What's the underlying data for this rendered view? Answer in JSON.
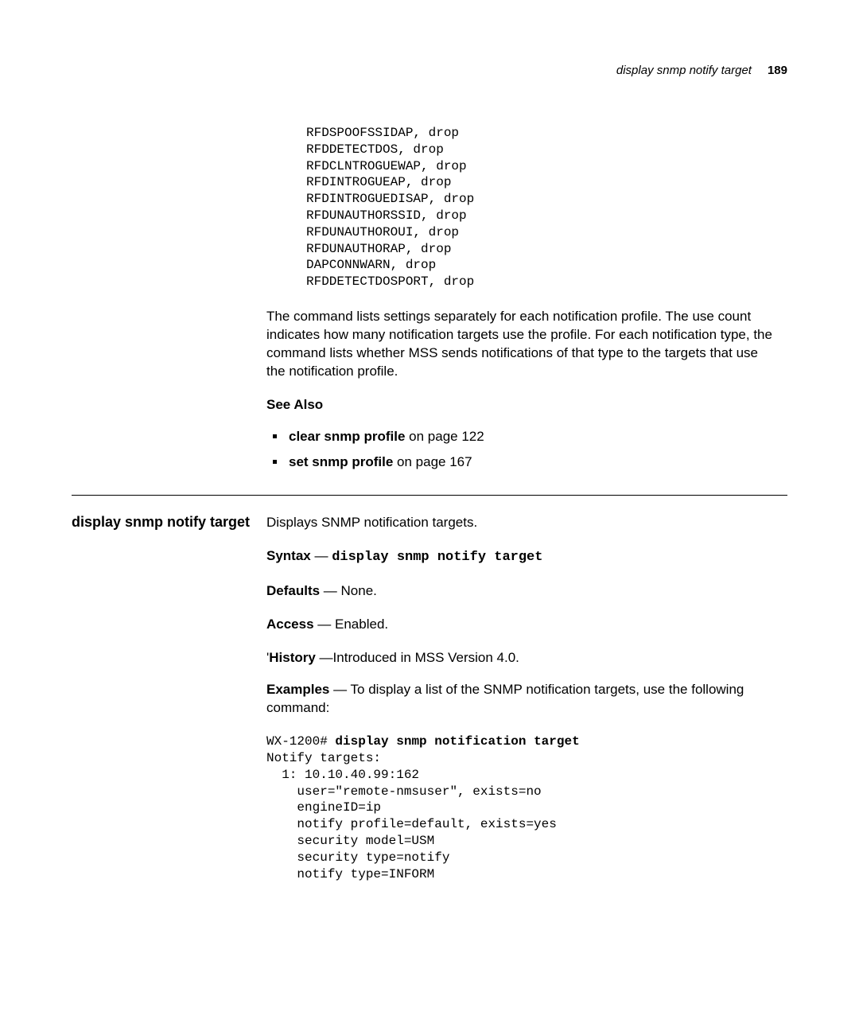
{
  "header": {
    "title": "display snmp notify target",
    "page": "189"
  },
  "upper": {
    "codeLines": "RFDSPOOFSSIDAP, drop\nRFDDETECTDOS, drop\nRFDCLNTROGUEWAP, drop\nRFDINTROGUEAP, drop\nRFDINTROGUEDISAP, drop\nRFDUNAUTHORSSID, drop\nRFDUNAUTHOROUI, drop\nRFDUNAUTHORAP, drop\nDAPCONNWARN, drop\nRFDDETECTDOSPORT, drop",
    "paragraph": "The command lists settings separately for each notification profile. The use count indicates how many notification targets use the profile. For each notification type, the command lists whether MSS sends notifications of that type to the targets that use the notification profile.",
    "seeAlsoHeading": "See Also",
    "seeAlso": [
      {
        "bold": "clear snmp profile",
        "rest": " on page 122"
      },
      {
        "bold": "set snmp profile",
        "rest": " on page 167"
      }
    ]
  },
  "section": {
    "sidebarTitle": "display snmp notify target",
    "intro": "Displays SNMP notification targets.",
    "syntax": {
      "label": "Syntax",
      "dash": " — ",
      "command": "display snmp notify target"
    },
    "defaults": {
      "label": "Defaults",
      "value": " — None."
    },
    "access": {
      "label": "Access",
      "value": " — Enabled."
    },
    "history": {
      "prefix": "'",
      "label": "History",
      "value": " —Introduced in MSS Version 4.0."
    },
    "examples": {
      "label": "Examples",
      "value": " — To display a list of the SNMP notification targets, use the following command:"
    },
    "outputPrompt": "WX-1200# ",
    "outputCommand": "display snmp notification target",
    "outputBody": "Notify targets:\n  1: 10.10.40.99:162\n    user=\"remote-nmsuser\", exists=no\n    engineID=ip\n    notify profile=default, exists=yes\n    security model=USM\n    security type=notify\n    notify type=INFORM"
  }
}
